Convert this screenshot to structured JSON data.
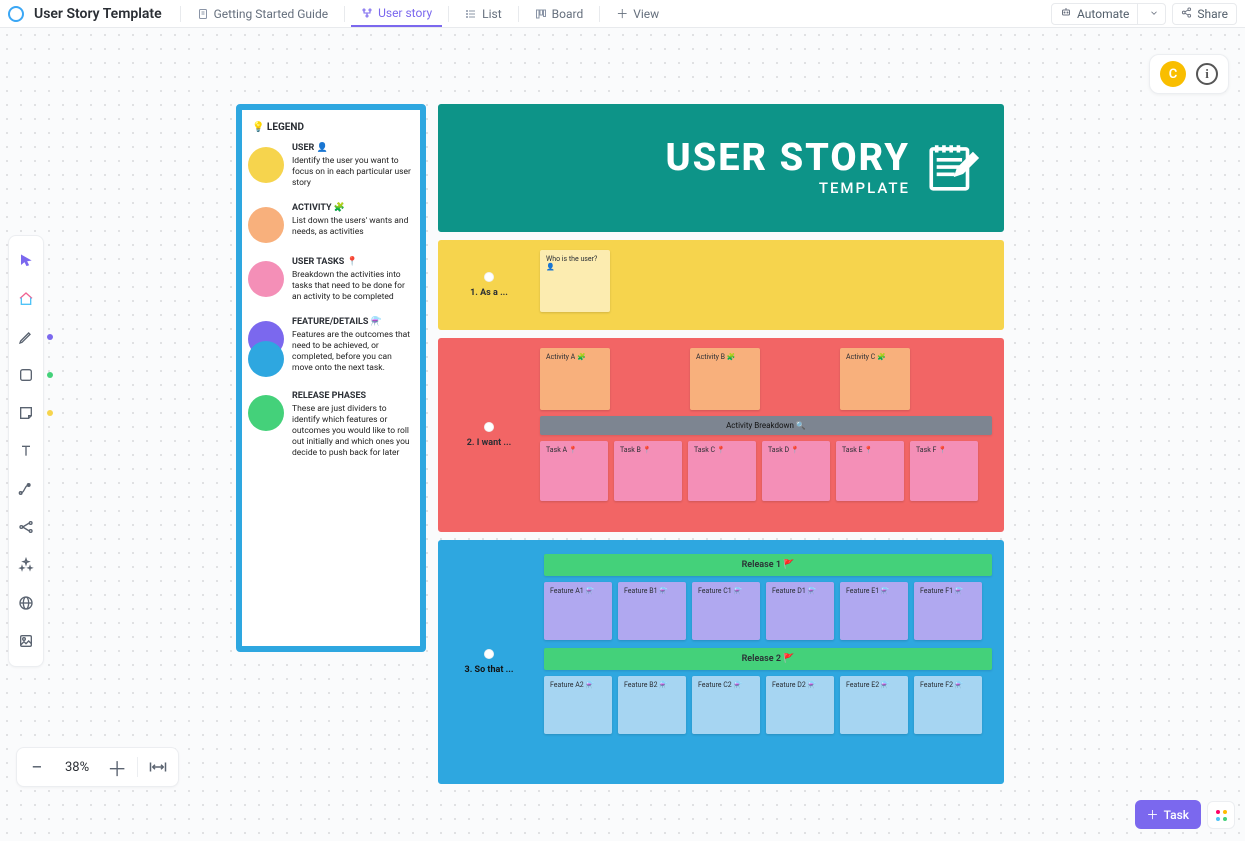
{
  "topbar": {
    "title": "User Story Template",
    "tabs": [
      {
        "label": "Getting Started Guide",
        "icon": "doc-icon"
      },
      {
        "label": "User story",
        "icon": "hierarchy-icon",
        "active": true
      },
      {
        "label": "List",
        "icon": "list-icon"
      },
      {
        "label": "Board",
        "icon": "board-icon"
      },
      {
        "label": "View",
        "icon": "plus-icon"
      }
    ],
    "automate": "Automate",
    "share": "Share"
  },
  "avatar": {
    "letter": "C"
  },
  "zoom": {
    "level": "38%"
  },
  "taskButton": {
    "label": "Task"
  },
  "leftTools": {
    "dots": {
      "purple": "#7b68ee",
      "green": "#44d17a",
      "yellow": "#f6d44d"
    }
  },
  "legend": {
    "title": "💡 LEGEND",
    "items": [
      {
        "color": "#f6d44d",
        "heading": "USER 👤",
        "text": "Identify the user you want to focus on in each particular user story"
      },
      {
        "color": "#f8b07c",
        "heading": "ACTIVITY 🧩",
        "text": "List down the users' wants and needs, as activities"
      },
      {
        "color": "#f48fb7",
        "heading": "USER TASKS 📍",
        "text": "Breakdown the activities into tasks that need to be done for an activity to be completed"
      },
      {
        "color": "stack",
        "heading": "FEATURE/DETAILS ⚗️",
        "text": "Features are the outcomes that need to be achieved, or completed, before you can move onto the next task."
      },
      {
        "color": "#44d17a",
        "heading": "RELEASE PHASES",
        "text": "These are just dividers to identify which features or outcomes you would like to roll out initially and which ones you decide to push back for later"
      }
    ]
  },
  "titleBlock": {
    "main": "USER STORY",
    "sub": "TEMPLATE"
  },
  "rows": {
    "asA": {
      "label": "1.  As a ...",
      "sticky": "Who is the user? 👤"
    },
    "iWant": {
      "label": "2.  I want ...",
      "activities": [
        "Activity A 🧩",
        "Activity B 🧩",
        "Activity C 🧩"
      ],
      "breakdown": "Activity Breakdown 🔍",
      "tasks": [
        "Task A 📍",
        "Task B 📍",
        "Task C 📍",
        "Task D 📍",
        "Task E 📍",
        "Task F 📍"
      ]
    },
    "soThat": {
      "label": "3.  So that ...",
      "release1": "Release 1 🚩",
      "features1": [
        "Feature A1 ⚗️",
        "Feature B1 ⚗️",
        "Feature C1 ⚗️",
        "Feature D1 ⚗️",
        "Feature E1 ⚗️",
        "Feature F1 ⚗️"
      ],
      "release2": "Release 2 🚩",
      "features2": [
        "Feature A2 ⚗️",
        "Feature B2 ⚗️",
        "Feature C2 ⚗️",
        "Feature D2 ⚗️",
        "Feature E2 ⚗️",
        "Feature F2 ⚗️"
      ]
    }
  }
}
